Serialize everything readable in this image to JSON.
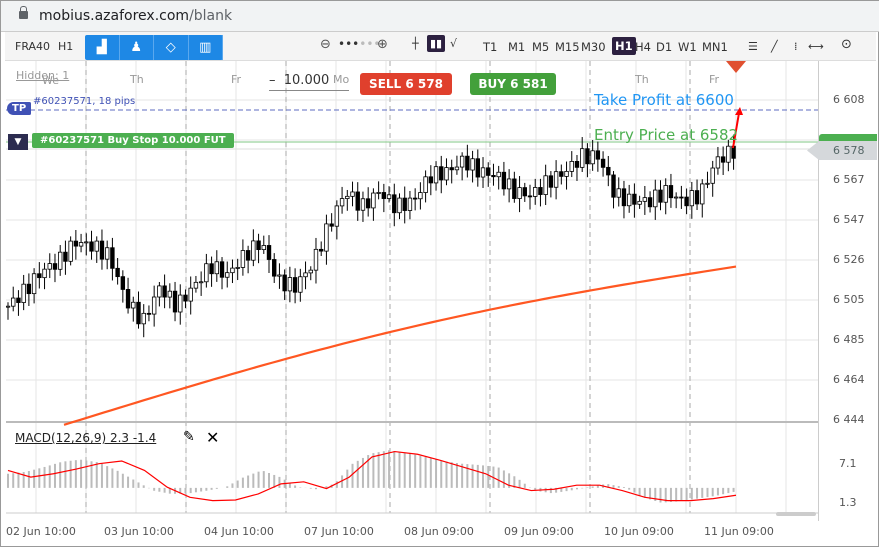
{
  "browser": {
    "url_host": "mobius.azaforex.com",
    "url_path": "/blank"
  },
  "toolbar": {
    "symbol": "FRA40",
    "period": "H1",
    "timeframes": [
      "T1",
      "M1",
      "M5",
      "M15",
      "M30",
      "H1",
      "H4",
      "D1",
      "W1",
      "MN1"
    ],
    "active_timeframe": "H1"
  },
  "chart": {
    "hidden_label": "Hidden: 1",
    "day_labels": [
      "We",
      "Th",
      "Fr",
      "Mo",
      "Th",
      "Fr"
    ],
    "volume": "10.000",
    "volume_minus": "–",
    "sell_label": "SELL 6 578",
    "buy_label": "BUY 6 581",
    "tp_badge": "TP",
    "tp_order": "#60237571, 18 pips",
    "order_label": "#60237571 Buy Stop 10.000 FUT",
    "take_profit_annotation": "Take Profit at 6600",
    "entry_annotation": "Entry Price at 6582",
    "current_price": "6 578",
    "price_axis": [
      "6 608",
      "6 578",
      "6 567",
      "6 547",
      "6 526",
      "6 505",
      "6 485",
      "6 464",
      "6 444"
    ],
    "macd_label": "MACD(12,26,9) 2.3 -1.4",
    "macd_axis": [
      "7.1",
      "1.3"
    ],
    "time_axis": [
      "02 Jun 10:00",
      "03 Jun 10:00",
      "04 Jun 10:00",
      "07 Jun 10:00",
      "08 Jun 09:00",
      "09 Jun 09:00",
      "10 Jun 09:00",
      "11 Jun 09:00"
    ],
    "colors": {
      "sell": "#e0402d",
      "buy": "#43a03b",
      "tp": "#3f51b5",
      "ma": "#ff5722",
      "macd_signal": "#ff0000",
      "histogram": "#bbbbbb"
    }
  },
  "chart_data": {
    "type": "candlestick",
    "closes": [
      6502,
      6510,
      6520,
      6525,
      6535,
      6533,
      6528,
      6505,
      6494,
      6512,
      6502,
      6512,
      6523,
      6518,
      6528,
      6535,
      6515,
      6512,
      6523,
      6543,
      6561,
      6553,
      6561,
      6553,
      6556,
      6569,
      6571,
      6577,
      6571,
      6569,
      6561,
      6559,
      6566,
      6571,
      6579,
      6579,
      6559,
      6556,
      6556,
      6561,
      6556,
      6559,
      6577,
      6582
    ],
    "ma_start": 6441,
    "ma_end": 6530,
    "macd_hist": [
      5.5,
      5.8,
      6.5,
      7.3,
      7.6,
      7.2,
      6,
      4.5,
      3,
      2.5,
      2.6,
      3,
      3.5,
      5,
      6,
      5,
      3.5,
      3.2,
      4,
      7,
      8.5,
      9,
      8.6,
      8,
      7.4,
      7,
      6.8,
      6.5,
      5,
      3,
      2.6,
      3,
      3.5,
      4,
      3.5,
      2,
      1.2,
      1.4,
      1.8,
      2.2,
      2.8
    ],
    "macd_signal": [
      6,
      5,
      5.5,
      6.2,
      7,
      7.4,
      6,
      3.5,
      2,
      1.5,
      1.6,
      2.5,
      4,
      4.3,
      3.3,
      5,
      8,
      8.8,
      8.4,
      7.5,
      6.5,
      5.5,
      3.8,
      3,
      3.2,
      3.8,
      3.8,
      3,
      2,
      1.5,
      1.5,
      1.8,
      2.3
    ],
    "ylim": [
      6444,
      6608
    ]
  }
}
